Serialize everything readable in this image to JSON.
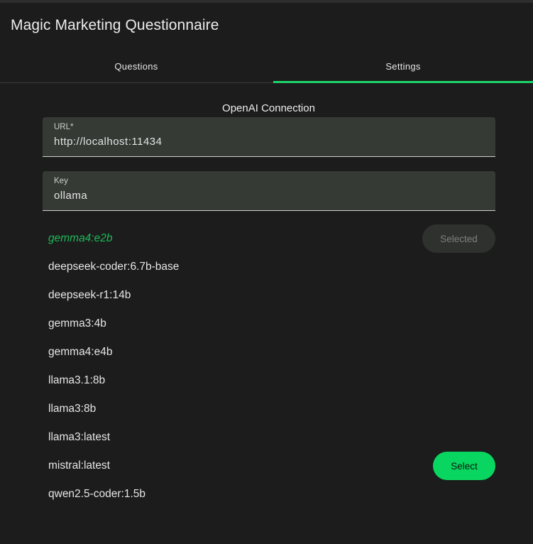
{
  "app": {
    "title": "Magic Marketing Questionnaire"
  },
  "tabs": [
    {
      "label": "Questions",
      "active": false
    },
    {
      "label": "Settings",
      "active": true
    }
  ],
  "connection": {
    "title": "OpenAI Connection",
    "url_label": "URL*",
    "url_value": "http://localhost:11434",
    "key_label": "Key",
    "key_value": "ollama"
  },
  "models": [
    {
      "name": "gemma4:e2b",
      "selected": true,
      "button": "Selected"
    },
    {
      "name": "deepseek-coder:6.7b-base",
      "selected": false
    },
    {
      "name": "deepseek-r1:14b",
      "selected": false
    },
    {
      "name": "gemma3:4b",
      "selected": false
    },
    {
      "name": "gemma4:e4b",
      "selected": false
    },
    {
      "name": "llama3.1:8b",
      "selected": false
    },
    {
      "name": "llama3:8b",
      "selected": false
    },
    {
      "name": "llama3:latest",
      "selected": false
    },
    {
      "name": "mistral:latest",
      "selected": false,
      "button": "Select"
    },
    {
      "name": "qwen2.5-coder:1.5b",
      "selected": false
    }
  ],
  "colors": {
    "accent": "#1ed36a",
    "background": "#1b1c1b",
    "selected_model_text": "#1fb85a"
  }
}
